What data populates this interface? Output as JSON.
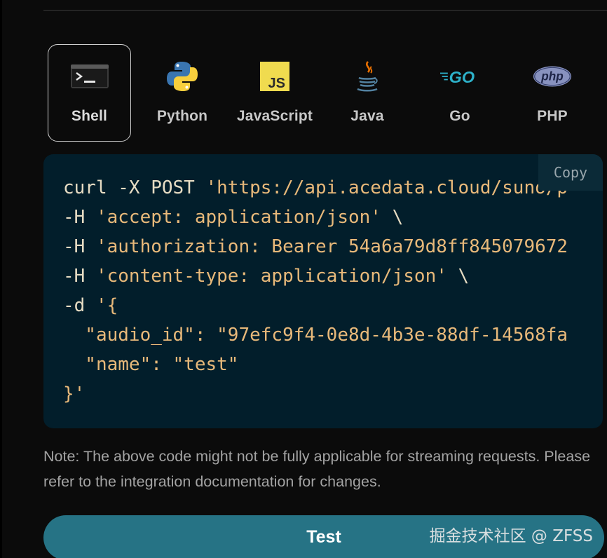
{
  "tabs": [
    {
      "id": "shell",
      "label": "Shell",
      "icon": "terminal-icon",
      "active": true
    },
    {
      "id": "python",
      "label": "Python",
      "icon": "python-logo-icon",
      "active": false
    },
    {
      "id": "javascript",
      "label": "JavaScript",
      "icon": "javascript-logo-icon",
      "active": false
    },
    {
      "id": "java",
      "label": "Java",
      "icon": "java-logo-icon",
      "active": false
    },
    {
      "id": "go",
      "label": "Go",
      "icon": "go-logo-icon",
      "active": false
    },
    {
      "id": "php",
      "label": "PHP",
      "icon": "php-logo-icon",
      "active": false
    }
  ],
  "icon_text": {
    "js": "JS",
    "go": "GO",
    "php": "php"
  },
  "code": {
    "copy_label": "Copy",
    "lines": [
      [
        {
          "t": "curl -X POST ",
          "c": "plain"
        },
        {
          "t": "'https://api.acedata.cloud/suno/p",
          "c": "str"
        }
      ],
      [
        {
          "t": "-H ",
          "c": "plain"
        },
        {
          "t": "'accept: application/json'",
          "c": "str"
        },
        {
          "t": " \\",
          "c": "plain"
        }
      ],
      [
        {
          "t": "-H ",
          "c": "plain"
        },
        {
          "t": "'authorization: Bearer 54a6a79d8ff845079672",
          "c": "str"
        }
      ],
      [
        {
          "t": "-H ",
          "c": "plain"
        },
        {
          "t": "'content-type: application/json'",
          "c": "str"
        },
        {
          "t": " \\",
          "c": "plain"
        }
      ],
      [
        {
          "t": "-d ",
          "c": "plain"
        },
        {
          "t": "'{",
          "c": "str"
        }
      ],
      [
        {
          "t": "  \"audio_id\": \"97efc9f4-0e8d-4b3e-88df-14568fa",
          "c": "str"
        }
      ],
      [
        {
          "t": "  \"name\": \"test\"",
          "c": "str"
        }
      ],
      [
        {
          "t": "}'",
          "c": "str"
        }
      ]
    ]
  },
  "note": {
    "text": "Note: The above code might not be fully applicable for streaming requests. Please refer to the integration documentation for changes."
  },
  "test_button": {
    "label": "Test"
  },
  "watermark": {
    "text": "掘金技术社区 @ ZFSS"
  },
  "colors": {
    "code_bg": "#021e2b",
    "string": "#e8b97a",
    "button": "#267385"
  }
}
